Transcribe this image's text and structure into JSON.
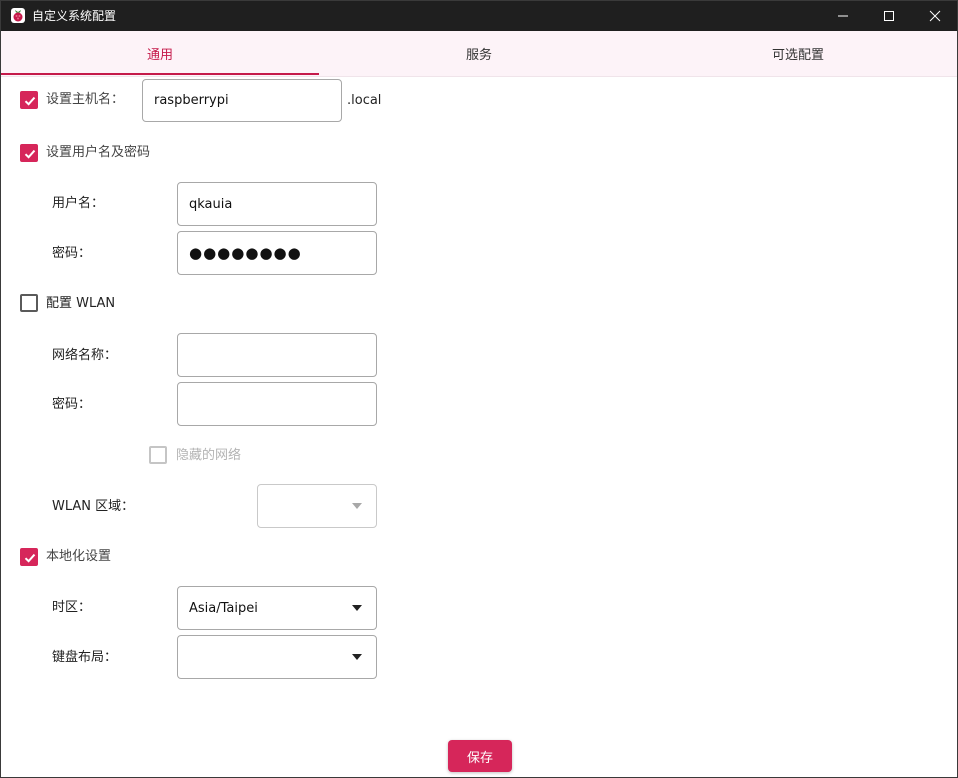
{
  "window": {
    "title": "自定义系统配置",
    "controls": [
      "minimize-icon",
      "maximize-icon",
      "close-icon"
    ]
  },
  "colors": {
    "accent": "#c51a4a",
    "checkbox_checked": "#d6265a",
    "tab_background": "#fdf3f8",
    "titlebar": "#1f1f1f"
  },
  "tabs": [
    {
      "label": "通用",
      "active": true
    },
    {
      "label": "服务",
      "active": false
    },
    {
      "label": "可选配置",
      "active": false
    }
  ],
  "hostname": {
    "label": "设置主机名：",
    "checked": true,
    "value": "raspberrypi",
    "suffix": ".local"
  },
  "user": {
    "label": "设置用户名及密码",
    "checked": true,
    "username_label": "用户名：",
    "username_value": "qkauia",
    "password_label": "密码：",
    "password_value": "●●●●●●●●"
  },
  "wlan": {
    "label": "配置 WLAN",
    "checked": false,
    "ssid_label": "网络名称：",
    "ssid_value": "",
    "password_label": "密码：",
    "password_value": "",
    "hidden_label": "隐藏的网络",
    "hidden_checked": false,
    "country_label": "WLAN 区域：",
    "country_value": ""
  },
  "locale": {
    "label": "本地化设置",
    "checked": true,
    "timezone_label": "时区：",
    "timezone_value": "Asia/Taipei",
    "keyboard_label": "键盘布局：",
    "keyboard_value": ""
  },
  "footer": {
    "save_label": "保存"
  }
}
